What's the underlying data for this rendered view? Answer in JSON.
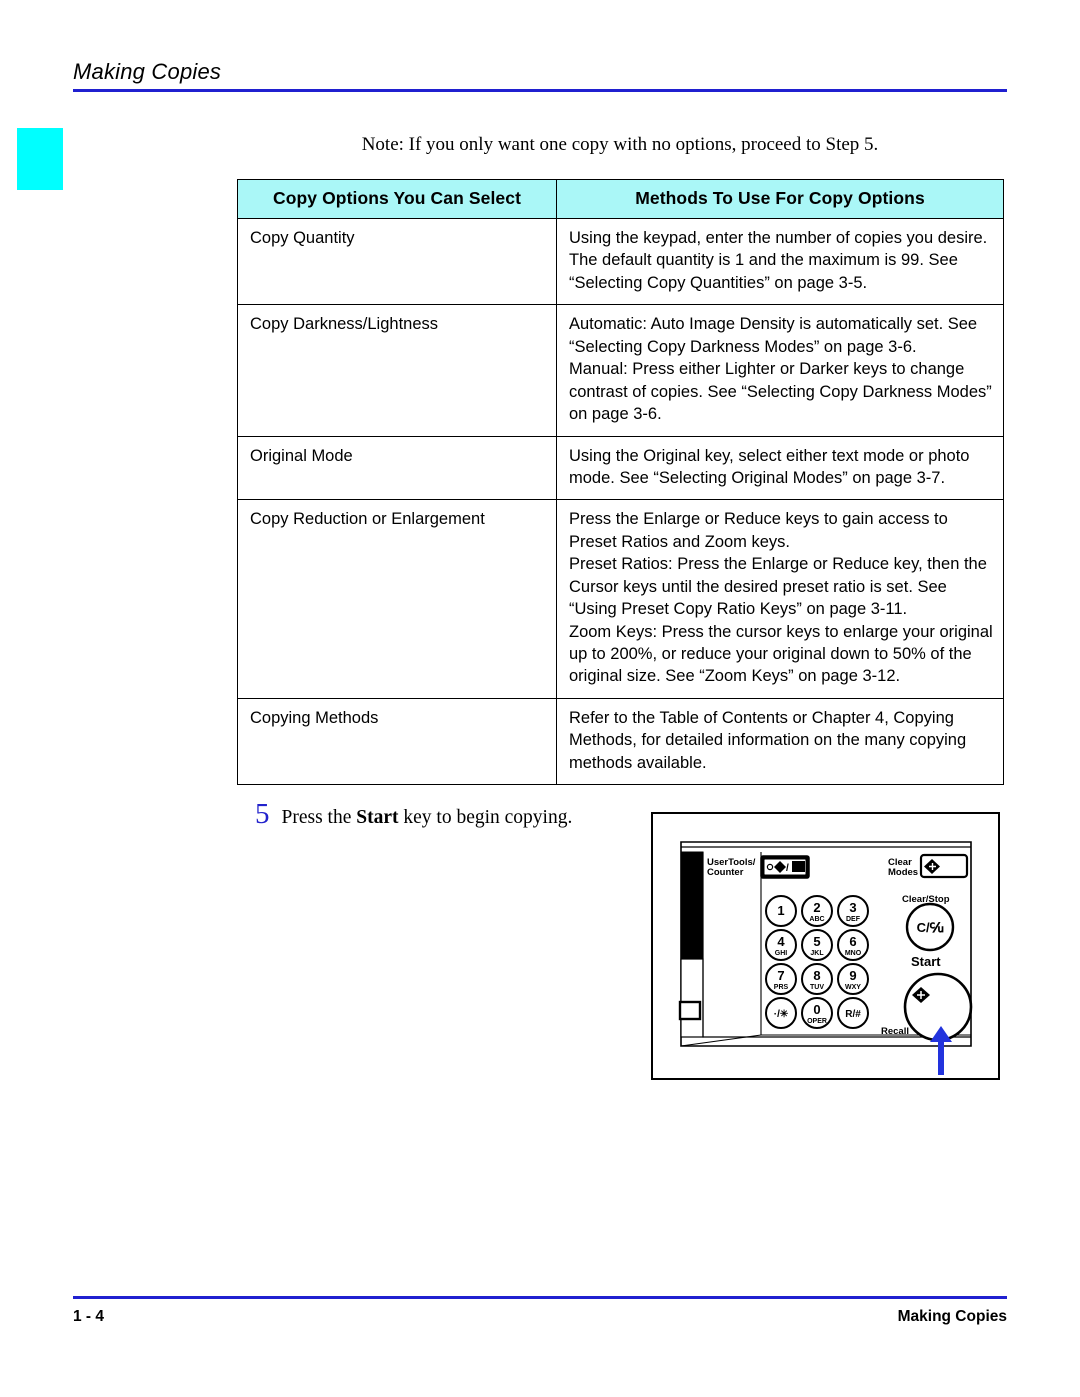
{
  "page": {
    "running_header": "Making Copies",
    "note": "Note:  If you only want one copy with no options, proceed to Step 5.",
    "accent_rule_color": "#2020d0",
    "tab_color": "#00ffff",
    "table_header_color": "#aaf7f7"
  },
  "table": {
    "headers": {
      "option": "Copy Options You Can Select",
      "method": "Methods To Use For Copy Options"
    },
    "rows": [
      {
        "option": "Copy Quantity",
        "method": [
          "Using the keypad, enter the number of copies you desire. The default quantity is 1 and the maximum is 99. See “Selecting Copy Quantities” on page 3-5."
        ]
      },
      {
        "option": "Copy Darkness/Lightness",
        "method": [
          "Automatic: Auto Image Density is automatically set. See “Selecting Copy Darkness Modes” on page 3-6.",
          "Manual: Press either Lighter or Darker keys to change contrast of copies. See “Selecting Copy Darkness Modes” on page 3-6."
        ]
      },
      {
        "option": "Original Mode",
        "method": [
          "Using the Original key, select either text mode or photo mode. See “Selecting Original Modes” on page 3-7."
        ]
      },
      {
        "option": "Copy Reduction or Enlargement",
        "method": [
          "Press the Enlarge or Reduce keys to gain access to Preset Ratios and Zoom keys.",
          "Preset Ratios: Press the Enlarge or Reduce key, then the Cursor keys until the desired preset ratio is set. See “Using Preset Copy Ratio Keys” on page 3-11.",
          "Zoom Keys: Press the cursor keys to enlarge your original up to 200%, or reduce your original down to 50% of the original size. See “Zoom Keys” on page 3-12."
        ]
      },
      {
        "option": "Copying Methods",
        "method": [
          "Refer to the Table of Contents or Chapter 4, Copying Methods, for detailed information on the many copying methods available."
        ]
      }
    ]
  },
  "step": {
    "number": "5",
    "text_before": "Press the ",
    "text_bold": "Start",
    "text_after": " key to begin copying."
  },
  "control_panel": {
    "labels": {
      "user_tools": "UserTools/",
      "user_tools_line2": "Counter",
      "clear_modes": "Clear",
      "clear_modes_line2": "Modes",
      "clear_stop": "Clear/Stop",
      "clear_stop_key": "C/Ⓔ",
      "start": "Start",
      "recall": "Recall"
    },
    "keypad": [
      {
        "digit": "1",
        "letters": ""
      },
      {
        "digit": "2",
        "letters": "ABC"
      },
      {
        "digit": "3",
        "letters": "DEF"
      },
      {
        "digit": "4",
        "letters": "GHI"
      },
      {
        "digit": "5",
        "letters": "JKL"
      },
      {
        "digit": "6",
        "letters": "MNO"
      },
      {
        "digit": "7",
        "letters": "PRS"
      },
      {
        "digit": "8",
        "letters": "TUV"
      },
      {
        "digit": "9",
        "letters": "WXY"
      },
      {
        "digit": "·/✳",
        "letters": ""
      },
      {
        "digit": "0",
        "letters": "OPER"
      },
      {
        "digit": "R/#",
        "letters": ""
      }
    ],
    "pointer_color": "#2233dd"
  },
  "footer": {
    "page_number": "1 - 4",
    "chapter": "Making Copies"
  }
}
